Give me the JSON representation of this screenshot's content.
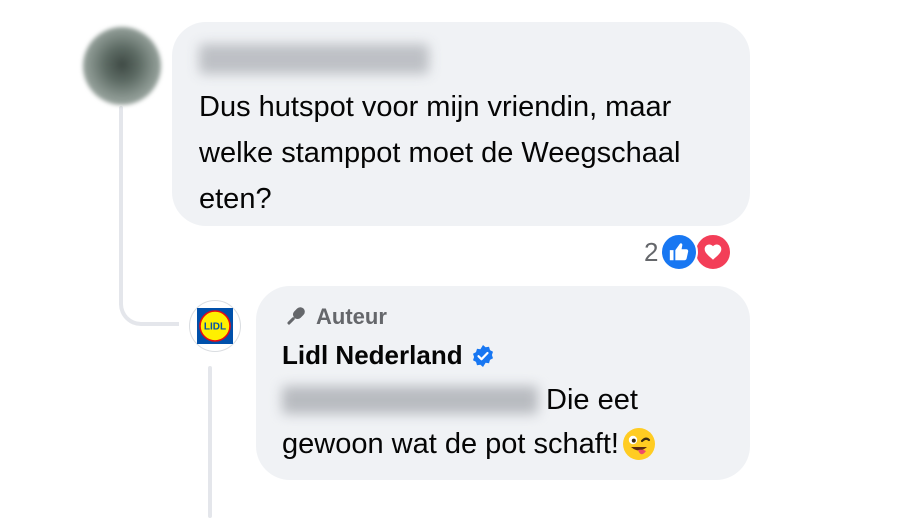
{
  "comment": {
    "author_name": "",
    "text": "Dus hutspot voor mijn vriendin, maar welke stamppot moet de Weegschaal eten?",
    "reactions": {
      "count": "2",
      "types": [
        "like-icon",
        "love-icon"
      ]
    }
  },
  "reply": {
    "badge_label": "Auteur",
    "badge_icon": "microphone-icon",
    "page_name": "Lidl Nederland",
    "verified_icon": "verified-badge-icon",
    "mentioned_name": "",
    "text_line1": "Die eet",
    "text_line2": "gewoon wat de pot schaft!",
    "emoji": "winking-face-with-tongue-emoji",
    "avatar_logo_text": "LIDL"
  },
  "colors": {
    "bubble": "#f0f2f5",
    "like_blue": "#1877f2",
    "love_red": "#f33e58",
    "lidl_blue": "#0050aa",
    "lidl_yellow": "#fff000",
    "lidl_red": "#e60a14",
    "secondary_text": "#65676b"
  }
}
